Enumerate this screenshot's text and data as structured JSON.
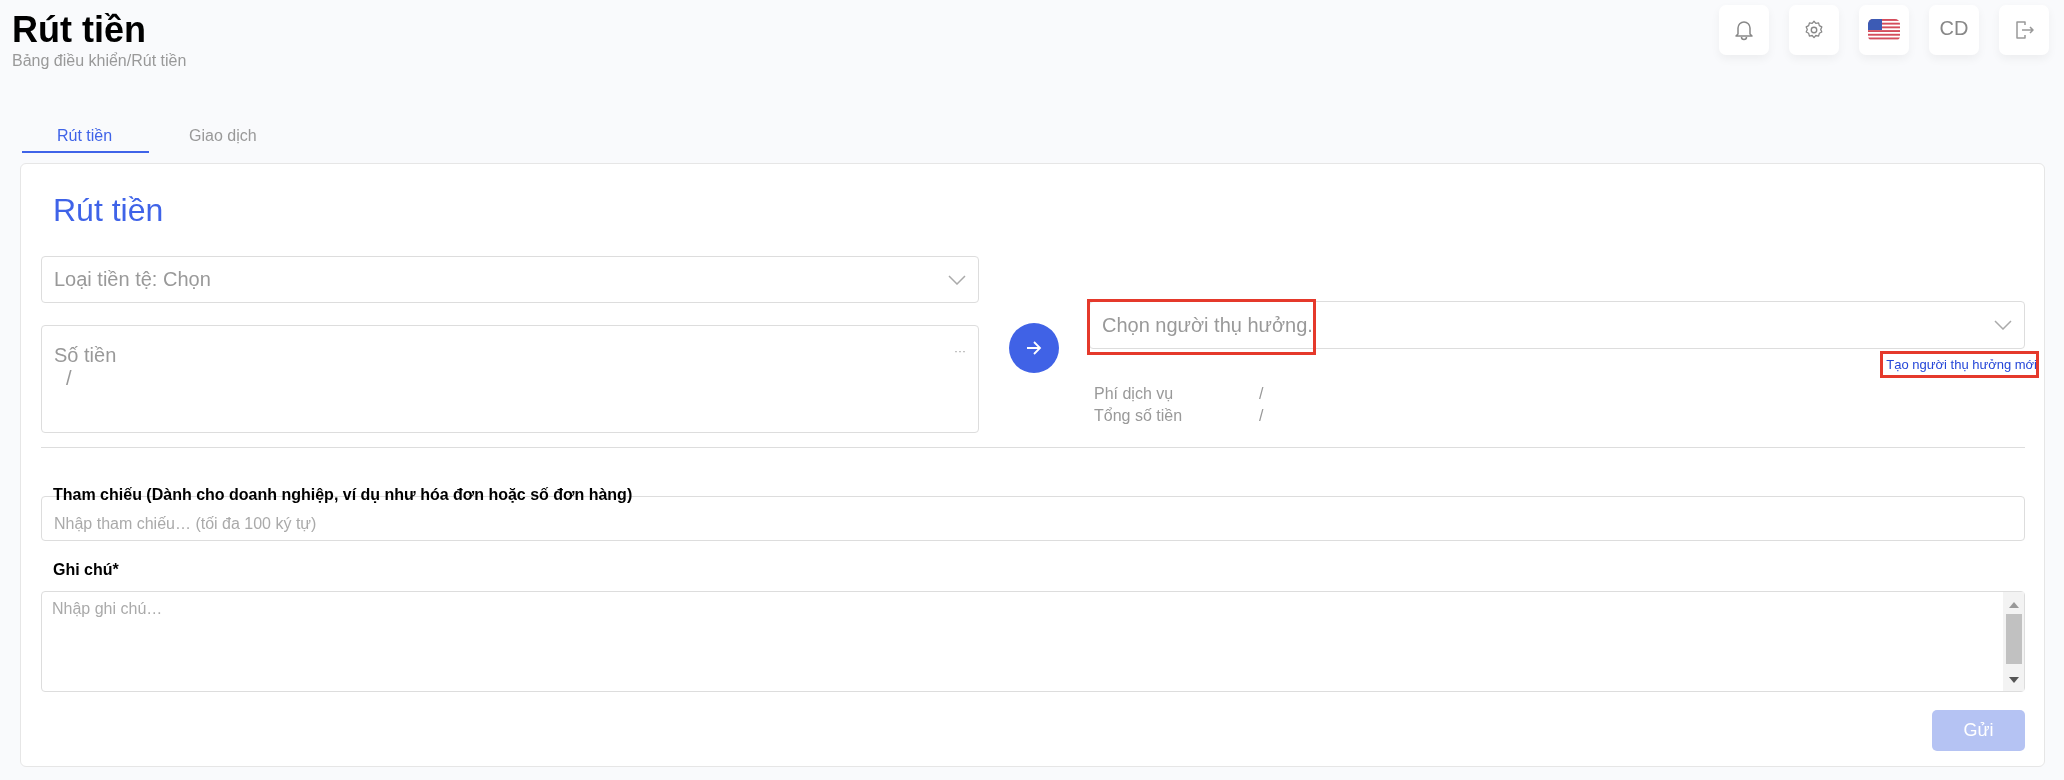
{
  "header": {
    "title": "Rút tiền",
    "breadcrumb": "Bảng điều khiển/Rút tiền",
    "avatar": "CD"
  },
  "tabs": [
    {
      "label": "Rút tiền",
      "selected": true
    },
    {
      "label": "Giao dịch",
      "selected": false
    }
  ],
  "card": {
    "title": "Rút tiền",
    "currency_select": {
      "placeholder": "Loại tiền tệ: Chọn"
    },
    "amount": {
      "label": "Số tiền",
      "value": "/",
      "more": "···"
    },
    "beneficiary_select": {
      "placeholder": "Chọn người thụ hưởng.",
      "highlighted": true
    },
    "create_link": {
      "label": "Tạo người thụ hưởng mới",
      "highlighted": true
    },
    "summary": [
      {
        "label": "Phí dịch vụ",
        "value": "/"
      },
      {
        "label": "Tổng số tiền",
        "value": "/"
      }
    ],
    "reference": {
      "label": "Tham chiếu (Dành cho doanh nghiệp, ví dụ như hóa đơn hoặc số đơn hàng)",
      "placeholder": "Nhập tham chiếu… (tối đa 100 ký tự)"
    },
    "note": {
      "label": "Ghi chú*",
      "placeholder": "Nhập ghi chú…"
    },
    "submit": {
      "label": "Gửi",
      "disabled": true
    }
  }
}
